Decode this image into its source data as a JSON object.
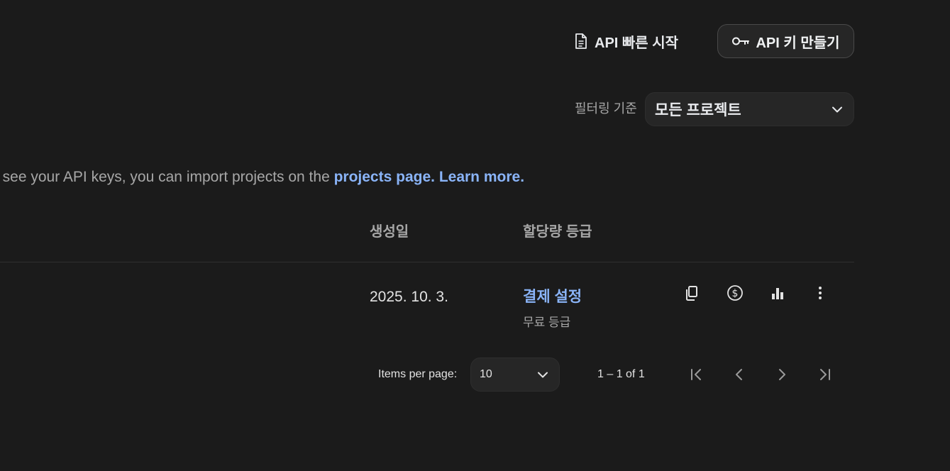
{
  "header": {
    "quickstart_label": "API 빠른 시작",
    "create_key_label": "API 키 만들기"
  },
  "filter": {
    "label": "필터링 기준",
    "selected": "모든 프로젝트"
  },
  "info": {
    "text": "'t see your API keys, you can import projects on the ",
    "link_projects": "projects page.",
    "link_learn": "Learn more."
  },
  "table": {
    "columns": [
      "생성일",
      "할당량 등급"
    ],
    "rows": [
      {
        "created": "2025. 10. 3.",
        "billing_link": "결제 설정",
        "tier": "무료 등급"
      }
    ]
  },
  "pagination": {
    "items_per_page_label": "Items per page:",
    "items_per_page_value": "10",
    "range_label": "1 – 1 of 1"
  },
  "icons": {
    "copy": "copy-icon",
    "billing": "dollar-circle-icon",
    "usage": "bar-chart-icon",
    "more": "more-vert-icon"
  }
}
